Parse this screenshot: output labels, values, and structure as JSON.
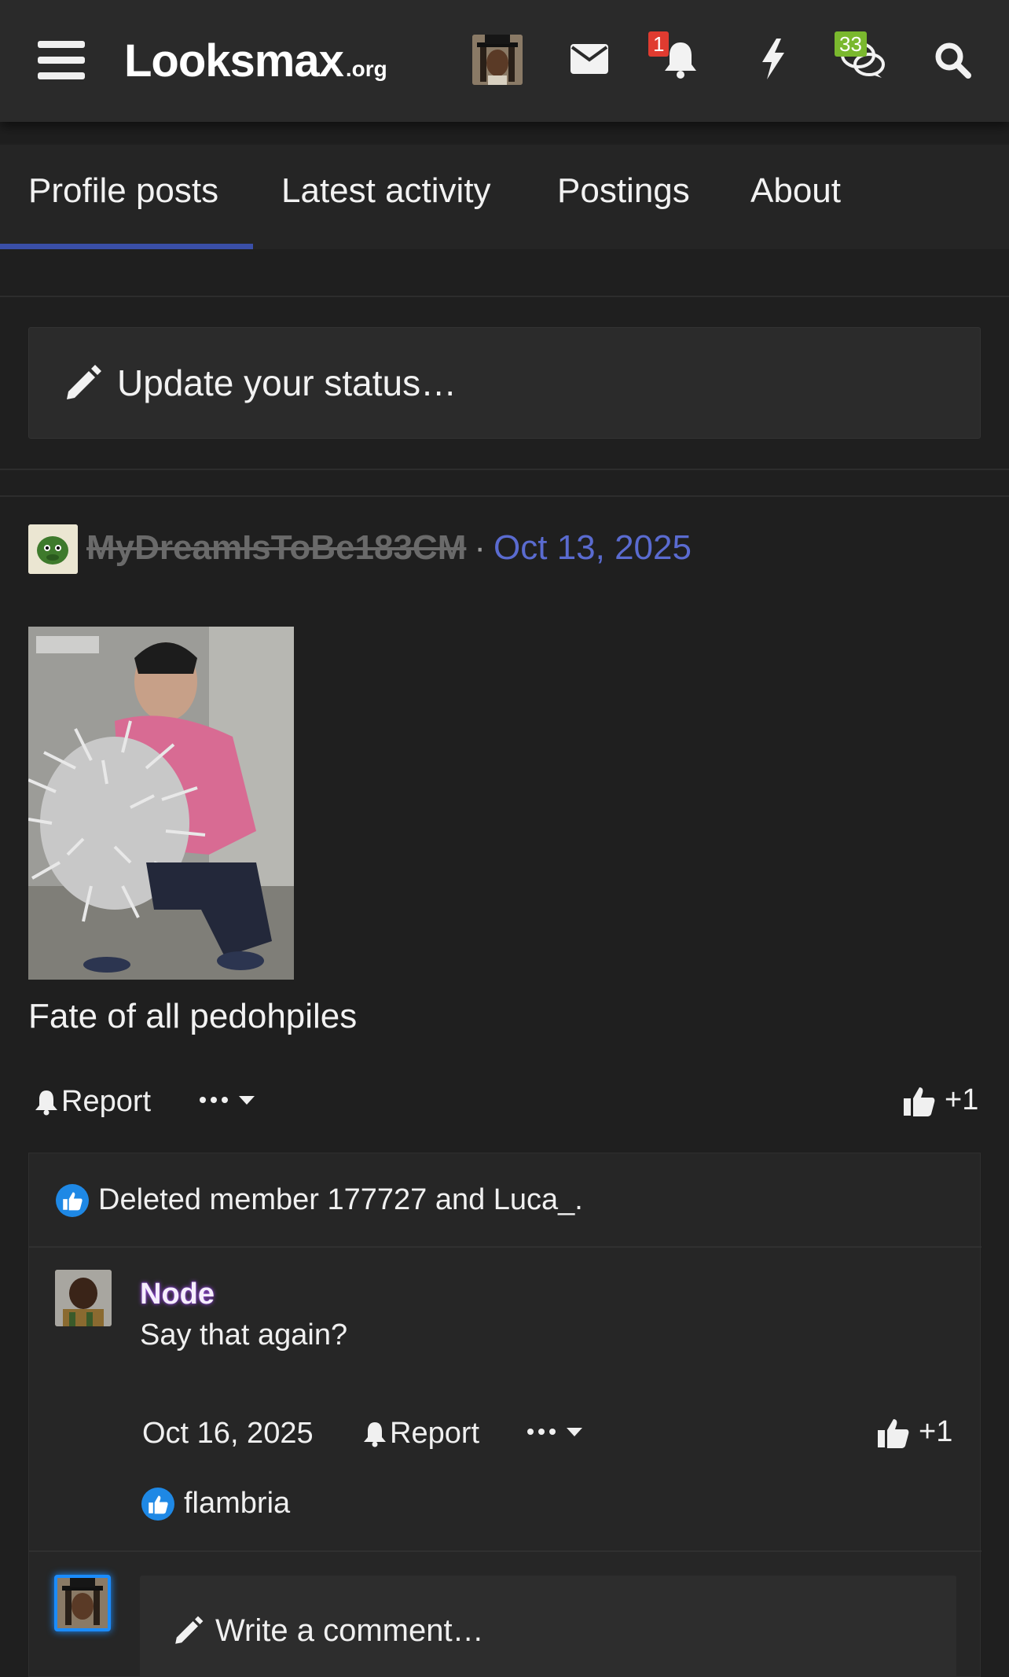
{
  "navbar": {
    "logo_main": "Looksmax",
    "logo_tld": ".org",
    "menu_icon": "hamburger-menu-icon",
    "avatar_icon": "user-avatar",
    "icons": [
      "envelope-icon",
      "bell-icon",
      "bolt-icon",
      "chat-bubbles-icon",
      "search-icon"
    ],
    "alerts_badge": "1",
    "conversations_badge": "33",
    "colors": {
      "alerts_badge": "#e03b30",
      "conversations_badge": "#7ab82e",
      "background": "#2a2a2a"
    }
  },
  "tabs": {
    "items": [
      {
        "label": "Profile posts",
        "active": true
      },
      {
        "label": "Latest activity",
        "active": false
      },
      {
        "label": "Postings",
        "active": false
      },
      {
        "label": "About",
        "active": false
      }
    ],
    "active_color": "#3a4fa8"
  },
  "status": {
    "placeholder": "Update your status…",
    "icon": "pencil-icon"
  },
  "post": {
    "author": "MyDreamIsToBe183CM",
    "separator": "·",
    "date": "Oct 13, 2025",
    "text": "Fate of all pedohpiles",
    "report_label": "Report",
    "reaction_count": "+1",
    "liked_by": "Deleted member 177727 and Luca_.",
    "date_color": "#5a6bd0"
  },
  "comment": {
    "author": "Node",
    "text": "Say that again?",
    "date": "Oct 16, 2025",
    "report_label": "Report",
    "reaction_count": "+1",
    "liked_by": "flambria",
    "author_glow_color": "#9a4fe0"
  },
  "comment_input": {
    "placeholder": "Write a comment…",
    "icon": "pencil-icon"
  }
}
